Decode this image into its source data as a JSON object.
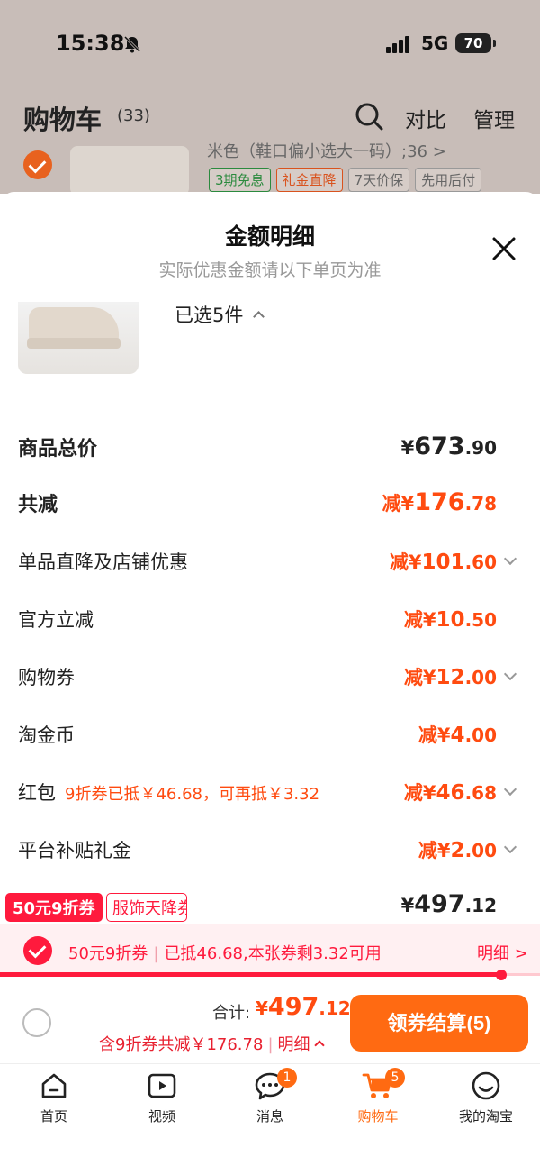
{
  "status_bar": {
    "time": "15:38",
    "network": "5G",
    "battery": "70"
  },
  "header": {
    "title": "购物车",
    "count": "(33)",
    "compare": "对比",
    "manage": "管理"
  },
  "background_item": {
    "spec": "米色（鞋口偏小选大一码）;36 >",
    "tags": [
      "3期免息",
      "礼金直降",
      "7天价保",
      "先用后付"
    ]
  },
  "sheet": {
    "title": "金额明细",
    "subtitle": "实际优惠金额请以下单页为准",
    "selected": "已选5件",
    "rows": [
      {
        "label": "商品总价",
        "prefix": "¥",
        "int": "673",
        "dec": ".90"
      },
      {
        "label": "共减",
        "prefix": "减¥",
        "int": "176",
        "dec": ".78"
      },
      {
        "label": "单品直降及店铺优惠",
        "prefix": "减¥",
        "int": "101",
        "dec": ".60"
      },
      {
        "label": "官方立减",
        "prefix": "减¥",
        "int": "10",
        "dec": ".50"
      },
      {
        "label": "购物券",
        "prefix": "减¥",
        "int": "12",
        "dec": ".00"
      },
      {
        "label": "淘金币",
        "prefix": "减¥",
        "int": "4",
        "dec": ".00"
      },
      {
        "label": "红包",
        "note": "9折券已抵￥46.68，可再抵￥3.32",
        "prefix": "减¥",
        "int": "46",
        "dec": ".68"
      },
      {
        "label": "平台补贴礼金",
        "prefix": "减¥",
        "int": "2",
        "dec": ".00"
      }
    ],
    "final": {
      "prefix": "¥",
      "int": "497",
      "dec": ".12"
    }
  },
  "coupon_tags": {
    "red": "50元9折券",
    "outline": "服饰天降券"
  },
  "coupon_bar": {
    "name": "50元9折券",
    "info": "已抵46.68,本张券剩3.32可用",
    "detail": "明细 >"
  },
  "progress": {
    "fraction": 0.93
  },
  "checkout": {
    "total_label": "合计:",
    "total_prefix": "¥",
    "total_int": "497",
    "total_dec": ".12",
    "sub": "含9折券共减￥176.78",
    "sub_link": "明细",
    "button": "领券结算(5)"
  },
  "tabs": [
    {
      "label": "首页",
      "icon": "home-icon"
    },
    {
      "label": "视频",
      "icon": "video-icon"
    },
    {
      "label": "消息",
      "icon": "message-icon",
      "badge": "1"
    },
    {
      "label": "购物车",
      "icon": "cart-icon",
      "badge": "5",
      "active": true
    },
    {
      "label": "我的淘宝",
      "icon": "profile-icon"
    }
  ],
  "colors": {
    "accent": "#ff6a12",
    "discount": "#ff4b10",
    "coupon": "#ff1a3d"
  }
}
